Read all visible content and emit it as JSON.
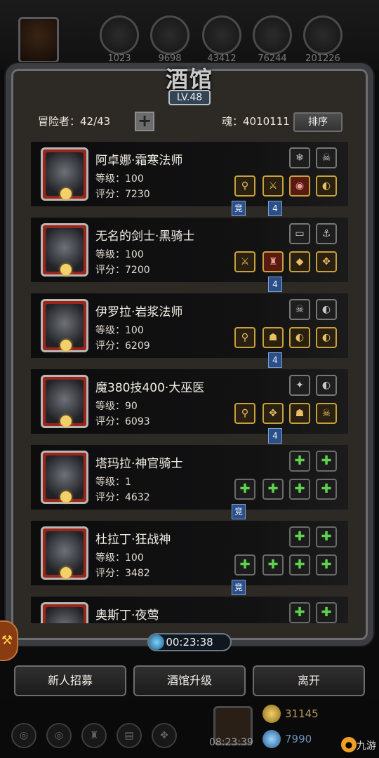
{
  "resources": [
    "1023",
    "9698",
    "43412",
    "76244",
    "201226"
  ],
  "title": "酒馆",
  "level": "LV.48",
  "adventurers_label": "冒险者：42/43",
  "plus_label": "+",
  "soul_label": "魂：4010111",
  "sort_label": "排序",
  "heroes": [
    {
      "name": "阿卓娜·霜寒法师",
      "level": "等级：100",
      "score": "评分：7230",
      "eq_top": [
        "❄",
        "☠"
      ],
      "eq_bottom": [
        "⚲",
        "⚔",
        "◉",
        "◐"
      ],
      "tabs": [
        "竞",
        "4"
      ]
    },
    {
      "name": "无名的剑士·黑骑士",
      "level": "等级：100",
      "score": "评分：7200",
      "eq_top": [
        "▭",
        "⚓"
      ],
      "eq_bottom": [
        "⚔",
        "♜",
        "◆",
        "✥"
      ],
      "tabs": [
        "4"
      ]
    },
    {
      "name": "伊罗拉·岩浆法师",
      "level": "等级：100",
      "score": "评分：6209",
      "eq_top": [
        "☠",
        "◐"
      ],
      "eq_bottom": [
        "⚲",
        "☗",
        "◐",
        "◐"
      ],
      "tabs": [
        "4"
      ]
    },
    {
      "name": "魔380技400·大巫医",
      "level": "等级：90",
      "score": "评分：6093",
      "eq_top": [
        "✦",
        "◐"
      ],
      "eq_bottom": [
        "⚲",
        "✥",
        "☗",
        "☠"
      ],
      "tabs": [
        "4"
      ]
    },
    {
      "name": "塔玛拉·神官骑士",
      "level": "等级：1",
      "score": "评分：4632",
      "eq_top": [
        "✚",
        "✚"
      ],
      "eq_bottom": [
        "✚",
        "✚",
        "✚",
        "✚"
      ],
      "tabs": [
        "竞"
      ]
    },
    {
      "name": "杜拉丁·狂战神",
      "level": "等级：100",
      "score": "评分：3482",
      "eq_top": [
        "✚",
        "✚"
      ],
      "eq_bottom": [
        "✚",
        "✚",
        "✚",
        "✚"
      ],
      "tabs": [
        "竞"
      ]
    },
    {
      "name": "奥斯丁·夜莺",
      "level": "",
      "score": "",
      "eq_top": [
        "✚",
        "✚"
      ],
      "eq_bottom": [],
      "tabs": []
    }
  ],
  "timer": "00:23:38",
  "buttons": {
    "recruit": "新人招募",
    "upgrade": "酒馆升级",
    "leave": "离开"
  },
  "clock": "08:23:39",
  "gold": "31145",
  "gems": "7990",
  "watermark": "九游",
  "colors": {
    "accent_blue": "#2b4f86",
    "frame": "#3c3d40",
    "gold_border": "#c8a13a",
    "green_plus": "#5ed34d"
  }
}
